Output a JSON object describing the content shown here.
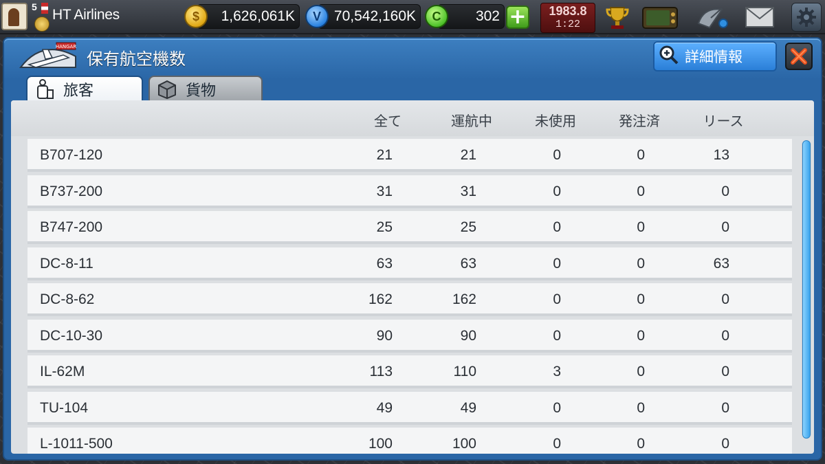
{
  "topbar": {
    "level": "5",
    "airline_name": "HT Airlines",
    "gold": "1,626,061K",
    "v_currency": "70,542,160K",
    "c_currency": "302",
    "date_year": "1983.8",
    "date_time": "1:22",
    "icons": [
      "trophy-icon",
      "tv-icon",
      "radar-icon",
      "mail-icon",
      "gear-icon"
    ]
  },
  "panel": {
    "title": "保有航空機数",
    "detail_button": "詳細情報",
    "hangar_label": "HANGAR",
    "tabs": [
      {
        "label": "旅客",
        "active": true
      },
      {
        "label": "貨物",
        "active": false
      }
    ]
  },
  "table": {
    "headers": [
      "全て",
      "運航中",
      "未使用",
      "発注済",
      "リース"
    ],
    "rows": [
      {
        "model": "B707-120",
        "all": "21",
        "operating": "21",
        "unused": "0",
        "ordered": "0",
        "lease": "13"
      },
      {
        "model": "B737-200",
        "all": "31",
        "operating": "31",
        "unused": "0",
        "ordered": "0",
        "lease": "0"
      },
      {
        "model": "B747-200",
        "all": "25",
        "operating": "25",
        "unused": "0",
        "ordered": "0",
        "lease": "0"
      },
      {
        "model": "DC-8-11",
        "all": "63",
        "operating": "63",
        "unused": "0",
        "ordered": "0",
        "lease": "63"
      },
      {
        "model": "DC-8-62",
        "all": "162",
        "operating": "162",
        "unused": "0",
        "ordered": "0",
        "lease": "0"
      },
      {
        "model": "DC-10-30",
        "all": "90",
        "operating": "90",
        "unused": "0",
        "ordered": "0",
        "lease": "0"
      },
      {
        "model": "IL-62M",
        "all": "113",
        "operating": "110",
        "unused": "3",
        "ordered": "0",
        "lease": "0"
      },
      {
        "model": "TU-104",
        "all": "49",
        "operating": "49",
        "unused": "0",
        "ordered": "0",
        "lease": "0"
      },
      {
        "model": "L-1011-500",
        "all": "100",
        "operating": "100",
        "unused": "0",
        "ordered": "0",
        "lease": "0"
      }
    ]
  },
  "colors": {
    "panel_blue": "#2a66a6",
    "button_blue": "#2a7fd8",
    "close_red": "#e8501e",
    "scroll_blue": "#3aa3ec"
  }
}
